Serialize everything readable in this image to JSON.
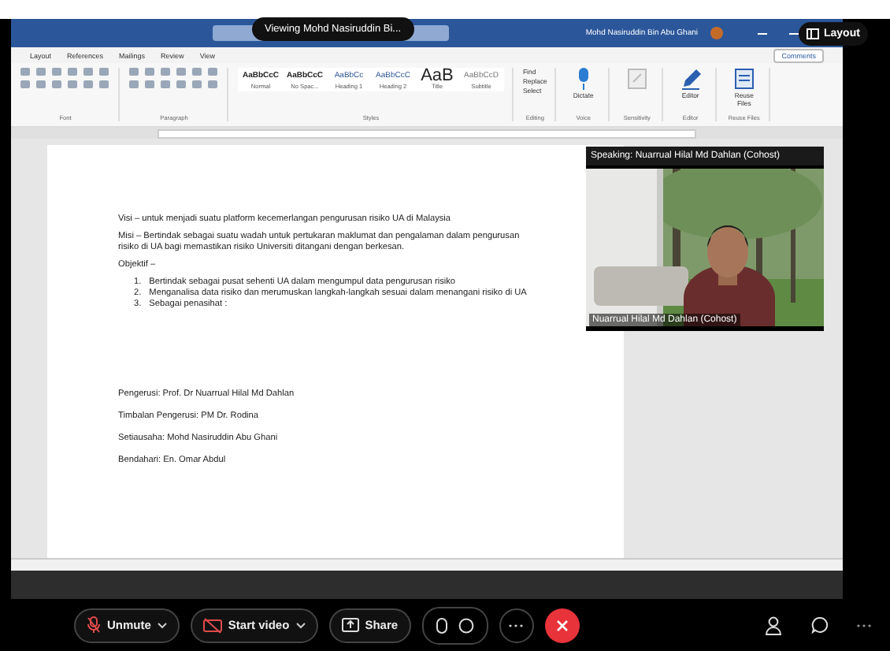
{
  "share_banner": {
    "label": "Viewing Mohd Nasiruddin Bi..."
  },
  "layout_button": {
    "label": "Layout"
  },
  "word": {
    "user_name": "Mohd Nasiruddin Bin Abu Ghani",
    "ribbon_tabs": [
      "Layout",
      "References",
      "Mailings",
      "Review",
      "View"
    ],
    "comments_button": "Comments",
    "styles": [
      {
        "sample": "AaBbCcC",
        "name": "Normal",
        "kind": "body"
      },
      {
        "sample": "AaBbCcC",
        "name": "No Spac...",
        "kind": "body"
      },
      {
        "sample": "AaBbCc",
        "name": "Heading 1",
        "kind": "heading"
      },
      {
        "sample": "AaBbCcC",
        "name": "Heading 2",
        "kind": "heading"
      },
      {
        "sample": "AaB",
        "name": "Title",
        "kind": "title"
      },
      {
        "sample": "AaBbCcD",
        "name": "Subtitle",
        "kind": "subtitle"
      }
    ],
    "editing": [
      "Find",
      "Replace",
      "Select"
    ],
    "big_buttons": [
      {
        "kind": "mic",
        "label": "Dictate",
        "group": "Voice"
      },
      {
        "kind": "sensitivity",
        "group": "Sensitivity"
      },
      {
        "kind": "pen",
        "label": "Editor",
        "group": "Editor"
      },
      {
        "kind": "files",
        "label": "Reuse Files",
        "group": "Reuse Files"
      }
    ],
    "group_labels": [
      "Font",
      "Paragraph",
      "Styles",
      "Editing"
    ]
  },
  "document": {
    "paragraphs": [
      "Visi – untuk menjadi suatu platform kecemerlangan pengurusan risiko UA di Malaysia",
      "Misi – Bertindak sebagai suatu wadah untuk pertukaran maklumat dan pengalaman dalam pengurusan risiko di UA bagi memastikan risiko Universiti ditangani dengan berkesan.",
      "Objektif –"
    ],
    "list": [
      {
        "number": "1.",
        "text": "Bertindak sebagai pusat sehenti UA dalam mengumpul data pengurusan risiko"
      },
      {
        "number": "2.",
        "text": "Menganalisa data risiko dan merumuskan langkah-langkah sesuai dalam menangani risiko di UA"
      },
      {
        "number": "3.",
        "text": "Sebagai penasihat :"
      }
    ],
    "committee": [
      "Pengerusi:  Prof. Dr Nuarrual Hilal Md Dahlan",
      "Timbalan Pengerusi: PM Dr. Rodina",
      "Setiausaha: Mohd Nasiruddin Abu Ghani",
      "Bendahari: En. Omar Abdul"
    ]
  },
  "video": {
    "speaking": "Speaking: Nuarrual Hilal Md Dahlan (Cohost)",
    "name": "Nuarrual Hilal Md Dahlan (Cohost)"
  },
  "toolbar": [
    {
      "kind": "mic-off",
      "label": "Unmute"
    },
    {
      "kind": "video-off",
      "label": "Start video"
    },
    {
      "kind": "share",
      "label": "Share"
    }
  ]
}
